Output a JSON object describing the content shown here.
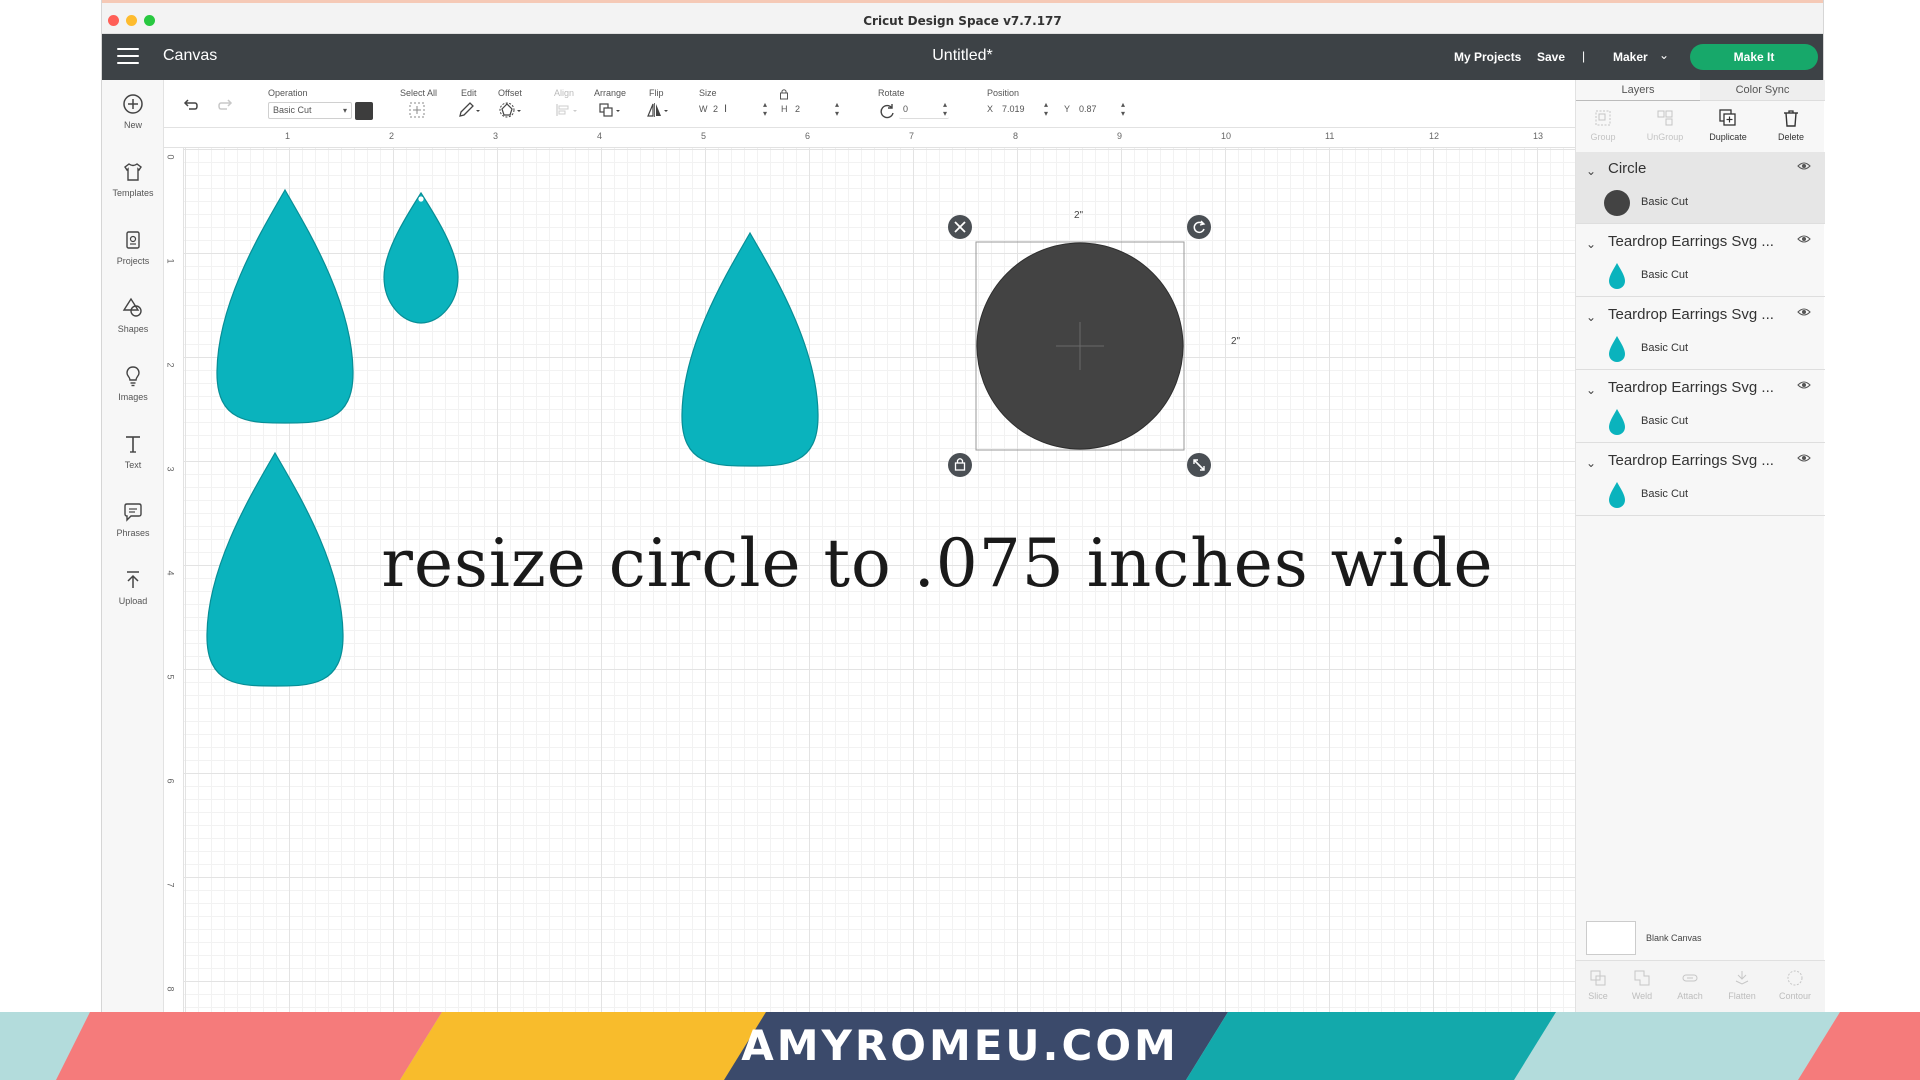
{
  "window": {
    "title": "Cricut Design Space  v7.7.177"
  },
  "header": {
    "canvas_label": "Canvas",
    "doc_title": "Untitled*",
    "my_projects": "My Projects",
    "save": "Save",
    "separator": "|",
    "machine": "Maker",
    "make_it": "Make It"
  },
  "left_toolbar": [
    {
      "label": "New",
      "icon": "plus-circle-icon"
    },
    {
      "label": "Templates",
      "icon": "shirt-icon"
    },
    {
      "label": "Projects",
      "icon": "projects-icon"
    },
    {
      "label": "Shapes",
      "icon": "shapes-icon"
    },
    {
      "label": "Images",
      "icon": "lightbulb-icon"
    },
    {
      "label": "Text",
      "icon": "text-icon"
    },
    {
      "label": "Phrases",
      "icon": "speech-bubble-icon"
    },
    {
      "label": "Upload",
      "icon": "upload-icon"
    }
  ],
  "edit_toolbar": {
    "operation_label": "Operation",
    "operation_value": "Basic Cut",
    "select_all_label": "Select All",
    "edit_label": "Edit",
    "offset_label": "Offset",
    "align_label": "Align",
    "arrange_label": "Arrange",
    "flip_label": "Flip",
    "size_label": "Size",
    "w_label": "W",
    "w_value": "2",
    "h_label": "H",
    "h_value": "2",
    "rotate_label": "Rotate",
    "rotate_value": "0",
    "position_label": "Position",
    "x_label": "X",
    "x_value": "7.019",
    "y_label": "Y",
    "y_value": "0.87",
    "operation_color": "#3d3d3d"
  },
  "ruler": {
    "top": [
      "1",
      "2",
      "3",
      "4",
      "5",
      "6",
      "7",
      "8",
      "9",
      "10",
      "11",
      "12",
      "13"
    ],
    "left": [
      "0",
      "1",
      "2",
      "3",
      "4",
      "5",
      "6",
      "7",
      "8"
    ]
  },
  "canvas": {
    "width_dim": "2\"",
    "height_dim": "2\"",
    "caption": "resize circle to .075 inches wide",
    "teardrop_color": "#0ab3bd",
    "circle_color": "#434343"
  },
  "right_panel": {
    "tabs": {
      "layers": "Layers",
      "color_sync": "Color Sync"
    },
    "actions": [
      {
        "label": "Group",
        "icon": "group-icon",
        "enabled": false
      },
      {
        "label": "UnGroup",
        "icon": "ungroup-icon",
        "enabled": false
      },
      {
        "label": "Duplicate",
        "icon": "duplicate-icon",
        "enabled": true
      },
      {
        "label": "Delete",
        "icon": "trash-icon",
        "enabled": true
      }
    ],
    "layers": [
      {
        "name": "Circle",
        "op": "Basic Cut",
        "thumb": "circle",
        "selected": true
      },
      {
        "name": "Teardrop Earrings Svg ...",
        "op": "Basic Cut",
        "thumb": "teardrop",
        "selected": false
      },
      {
        "name": "Teardrop Earrings Svg ...",
        "op": "Basic Cut",
        "thumb": "teardrop",
        "selected": false
      },
      {
        "name": "Teardrop Earrings Svg ...",
        "op": "Basic Cut",
        "thumb": "teardrop",
        "selected": false
      },
      {
        "name": "Teardrop Earrings Svg ...",
        "op": "Basic Cut",
        "thumb": "teardrop",
        "selected": false
      }
    ],
    "blank_canvas": "Blank Canvas",
    "bottom_actions": [
      {
        "label": "Slice",
        "icon": "slice-icon"
      },
      {
        "label": "Weld",
        "icon": "weld-icon"
      },
      {
        "label": "Attach",
        "icon": "attach-icon"
      },
      {
        "label": "Flatten",
        "icon": "flatten-icon"
      },
      {
        "label": "Contour",
        "icon": "contour-icon"
      }
    ]
  },
  "banner": {
    "text": "AMYROMEU.COM",
    "colors": [
      "#f57b7b",
      "#f8bc2c",
      "#3b4a6b",
      "#13a9ab",
      "#b3dcdc"
    ]
  }
}
